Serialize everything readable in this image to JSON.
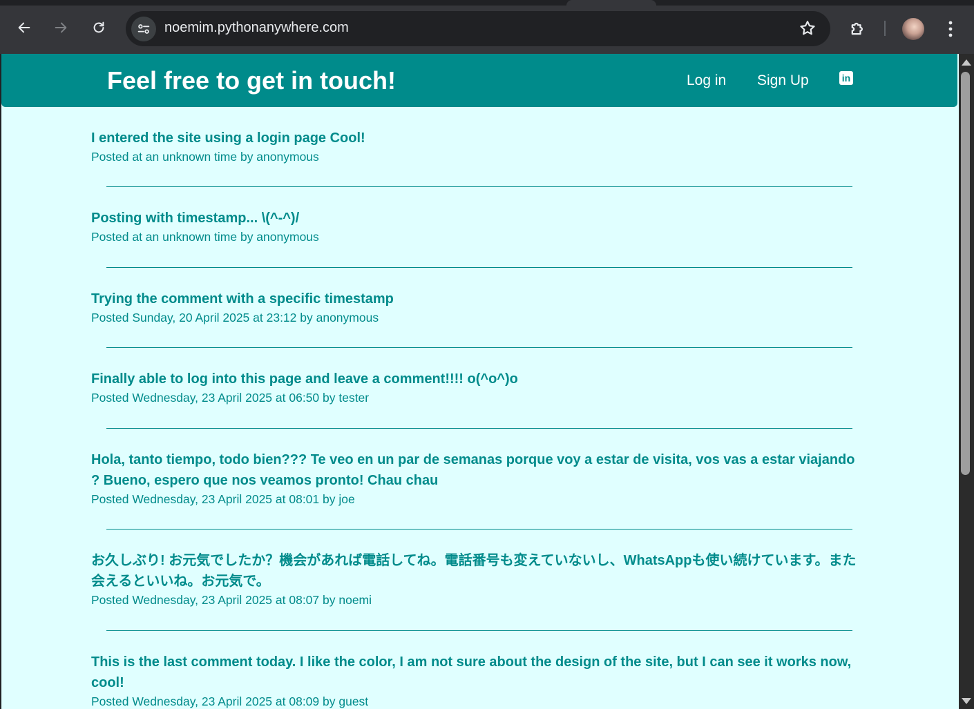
{
  "browser": {
    "url": "noemim.pythonanywhere.com"
  },
  "site": {
    "title": "Feel free to get in touch!",
    "nav": {
      "login": "Log in",
      "signup": "Sign Up",
      "linkedin_icon": "linkedin-icon"
    }
  },
  "comments": [
    {
      "text": "I entered the site using a login page Cool!",
      "meta": "Posted at an unknown time by anonymous"
    },
    {
      "text": "Posting with timestamp... \\(^-^)/",
      "meta": "Posted at an unknown time by anonymous"
    },
    {
      "text": "Trying the comment with a specific timestamp",
      "meta": "Posted Sunday, 20 April 2025 at 23:12 by anonymous"
    },
    {
      "text": "Finally able to log into this page and leave a comment!!!! o(^o^)o",
      "meta": "Posted Wednesday, 23 April 2025 at 06:50 by tester"
    },
    {
      "text": "Hola, tanto tiempo, todo bien??? Te veo en un par de semanas porque voy a estar de visita, vos vas a estar viajando ? Bueno, espero que nos veamos pronto! Chau chau",
      "meta": "Posted Wednesday, 23 April 2025 at 08:01 by joe"
    },
    {
      "text": "お久しぶり! お元気でしたか？機会があれば電話してね。電話番号も変えていないし、WhatsAppも使い続けています。また会えるといいね。お元気で。",
      "meta": "Posted Wednesday, 23 April 2025 at 08:07 by noemi"
    },
    {
      "text": "This is the last comment today. I like the color, I am not sure about the design of the site, but I can see it works now, cool!",
      "meta": "Posted Wednesday, 23 April 2025 at 08:09 by guest"
    }
  ],
  "colors": {
    "accent": "#008b8b",
    "background": "#e0ffff"
  }
}
